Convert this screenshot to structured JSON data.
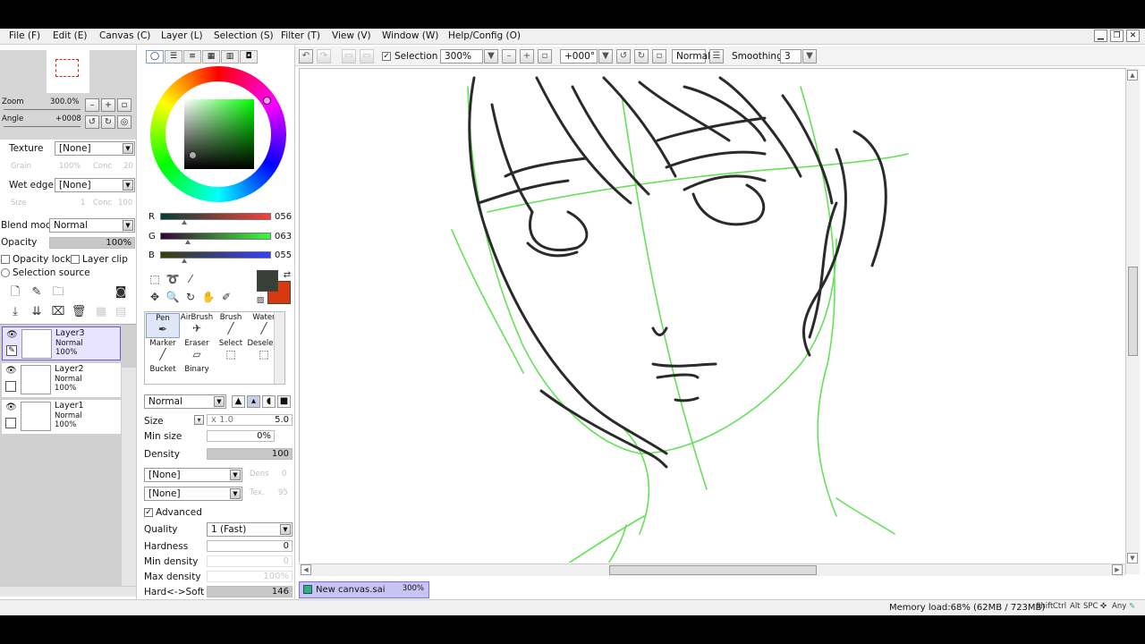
{
  "menu": [
    "File (F)",
    "Edit (E)",
    "Canvas (C)",
    "Layer (L)",
    "Selection (S)",
    "Filter (T)",
    "View (V)",
    "Window (W)",
    "Help/Config (O)"
  ],
  "navigator": {
    "zoom_label": "Zoom",
    "zoom_value": "300.0%",
    "angle_label": "Angle",
    "angle_value": "+0008"
  },
  "texture": {
    "label": "Texture",
    "value": "[None]",
    "grain_label": "Grain",
    "grain_value": "100%",
    "conc_label": "Conc",
    "conc_value": "20"
  },
  "wet_edge": {
    "label": "Wet edge",
    "value": "[None]",
    "size_label": "Size",
    "size_value": "1",
    "conc_label": "Conc",
    "conc_value": "100"
  },
  "blend": {
    "label": "Blend mode",
    "value": "Normal"
  },
  "opacity": {
    "label": "Opacity",
    "value": "100%"
  },
  "layer_options": {
    "opacity_lock": "Opacity lock",
    "layer_clip": "Layer clip",
    "selection_source": "Selection source"
  },
  "layers": [
    {
      "name": "Layer3",
      "mode": "Normal",
      "opacity": "100%"
    },
    {
      "name": "Layer2",
      "mode": "Normal",
      "opacity": "100%"
    },
    {
      "name": "Layer1",
      "mode": "Normal",
      "opacity": "100%"
    }
  ],
  "color": {
    "r_label": "R",
    "g_label": "G",
    "b_label": "B",
    "r_value": "056",
    "g_value": "063",
    "b_value": "055",
    "r": 56,
    "g": 63,
    "b": 55,
    "fg_color": "#383f37",
    "bg_color": "#d83a10"
  },
  "brushes": [
    "Pen",
    "AirBrush",
    "Brush",
    "Water",
    "Marker",
    "Eraser",
    "Select",
    "Deselect",
    "Bucket",
    "Binary"
  ],
  "tool_settings": {
    "blend_value": "Normal",
    "size_label": "Size",
    "size_mult": "x 1.0",
    "size_value": "5.0",
    "min_size_label": "Min size",
    "min_size_value": "0%",
    "density_label": "Density",
    "density_value": "100",
    "shape_value": "[None]",
    "texture_value": "[None]",
    "dens_label": "Dens",
    "dens_value": "0",
    "tex_label": "Tex.",
    "tex_value": "95",
    "advanced_label": "Advanced",
    "quality_label": "Quality",
    "quality_value": "1 (Fast)",
    "hardness_label": "Hardness",
    "hardness_value": "0",
    "min_density_label": "Min density",
    "min_density_value": "0",
    "max_density_label": "Max density",
    "max_density_value": "100%",
    "hard_soft_label": "Hard<->Soft",
    "hard_soft_value": "146"
  },
  "toolbar": {
    "selection_label": "Selection",
    "zoom_value": "300%",
    "angle_value": "+000°",
    "blend_value": "Normal",
    "smoothing_label": "Smoothing",
    "smoothing_value": "3"
  },
  "document": {
    "name": "New canvas.sai",
    "zoom": "300%"
  },
  "status": {
    "memory": "Memory load:68% (62MB / 723MB)",
    "keys": [
      "Shift",
      "Ctrl",
      "Alt",
      "SPC",
      "Any"
    ]
  },
  "colors": {
    "selection_accent": "#7b70d3",
    "guide_green": "#4bdc3c",
    "ink": "#2a2a2a"
  }
}
